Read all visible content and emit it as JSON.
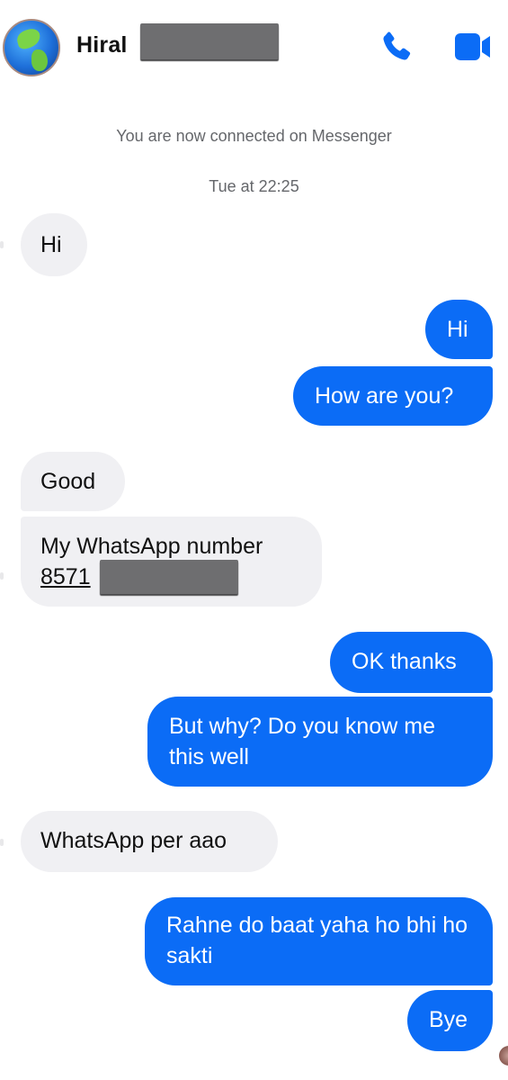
{
  "header": {
    "contact_name": "Hiral",
    "avatar_icon": "globe-avatar",
    "call_icon": "phone-icon",
    "video_icon": "video-camera-icon",
    "accent_color": "#0b6cf6"
  },
  "system_messages": [
    "You are now connected on Messenger",
    "Tue at 22:25"
  ],
  "messages": [
    {
      "sender": "them",
      "text": "Hi"
    },
    {
      "sender": "me",
      "text": "Hi"
    },
    {
      "sender": "me",
      "text": "How are you?"
    },
    {
      "sender": "them",
      "text": "Good"
    },
    {
      "sender": "them",
      "text": "My WhatsApp number",
      "phone_visible": "8571",
      "phone_redacted": true
    },
    {
      "sender": "me",
      "text": "OK thanks"
    },
    {
      "sender": "me",
      "text": "But why? Do you know me this well"
    },
    {
      "sender": "them",
      "text": "WhatsApp per aao"
    },
    {
      "sender": "me",
      "text": "Rahne do baat yaha ho bhi ho sakti"
    },
    {
      "sender": "me",
      "text": "Bye"
    }
  ],
  "colors": {
    "outgoing_bubble": "#0b6cf6",
    "incoming_bubble": "#f0f0f3",
    "system_text": "#65676b"
  }
}
